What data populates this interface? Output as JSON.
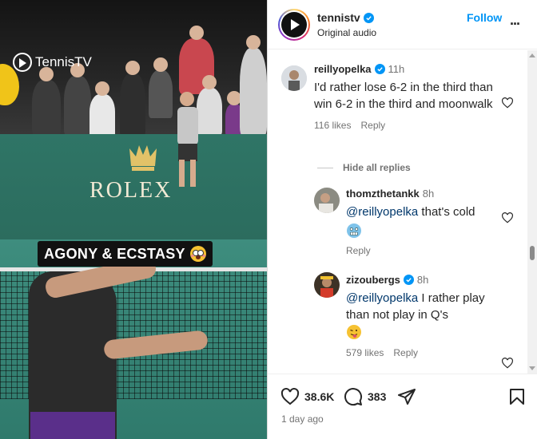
{
  "video": {
    "brand": "TennisTV",
    "sponsor": "ROLEX",
    "caption": "AGONY & ECSTASY",
    "caption_emoji": "flushed-face-emoji"
  },
  "post": {
    "username": "tennistv",
    "audio": "Original audio",
    "follow_label": "Follow",
    "more_label": "..."
  },
  "comments": [
    {
      "username": "reillyopelka",
      "verified": true,
      "time": "11h",
      "text": "I'd rather lose 6-2 in the third than win 6-2 in the third and moonwalk",
      "likes": "116 likes",
      "reply_label": "Reply"
    }
  ],
  "hide_replies_label": "Hide all replies",
  "replies": [
    {
      "username": "thomzthetankk",
      "verified": false,
      "time": "8h",
      "mention": "@reillyopelka",
      "text": " that's cold",
      "emoji": "cold-face-emoji",
      "reply_label": "Reply"
    },
    {
      "username": "zizoubergs",
      "verified": true,
      "time": "8h",
      "mention": "@reillyopelka",
      "text": " I rather play than not play in Q's",
      "emoji": "tongue-face-emoji",
      "likes": "579 likes",
      "reply_label": "Reply"
    }
  ],
  "actions": {
    "like_count": "38.6K",
    "comment_count": "383",
    "date": "1 day ago"
  },
  "colors": {
    "accent": "#0095f6",
    "text": "#262626",
    "muted": "#737373",
    "mention": "#00376b"
  }
}
